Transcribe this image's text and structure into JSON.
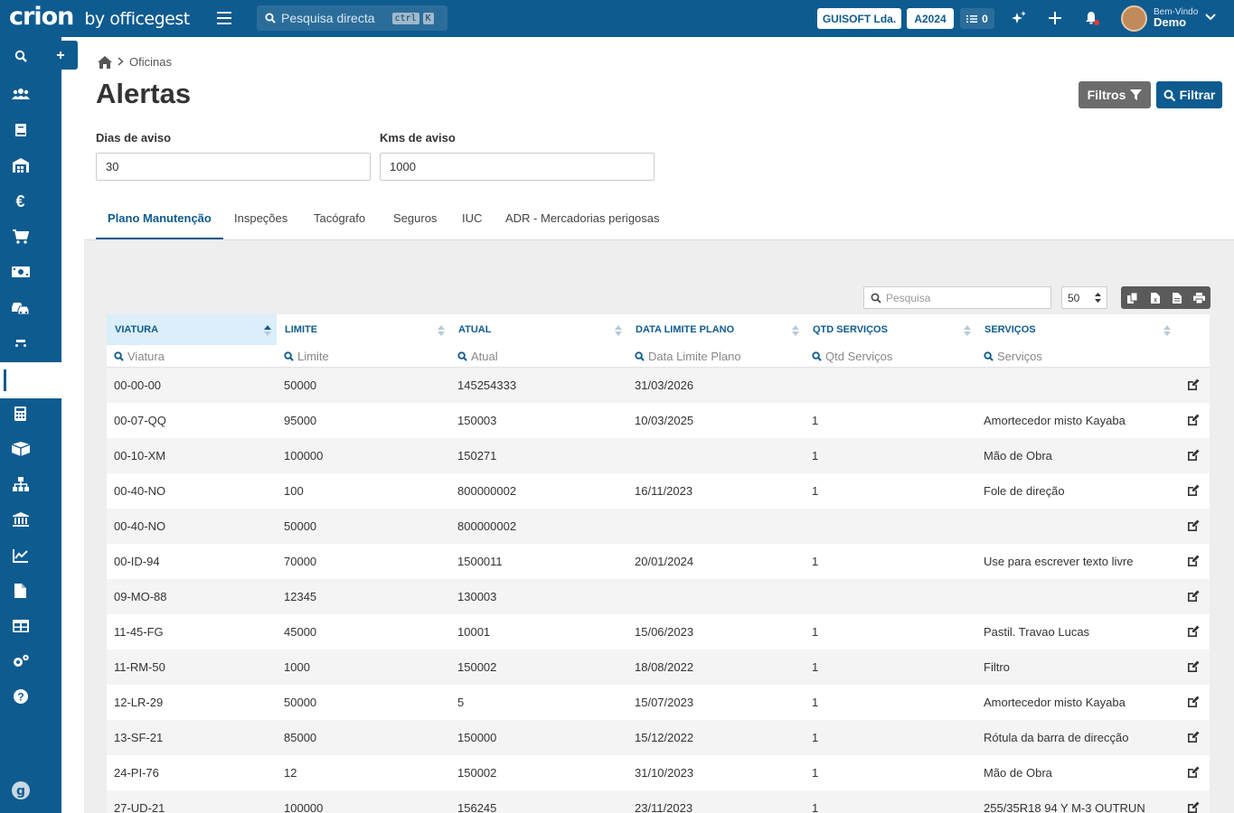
{
  "topbar": {
    "logo_main": "crion",
    "logo_sub": "by officegest",
    "search_placeholder": "Pesquisa directa",
    "shortcut_ctrl": "ctrl",
    "shortcut_k": "K",
    "company": "GUISOFT Lda.",
    "year": "A2024",
    "tasks_count": "0",
    "greeting": "Bem-Vindo",
    "username": "Demo"
  },
  "sidebar": {
    "items": [
      "search-icon",
      "users-icon",
      "book-icon",
      "warehouse-icon",
      "euro-icon",
      "cart-icon",
      "money-icon",
      "cars-icon",
      "car-icon",
      "plus-icon",
      "calculator-icon",
      "box-icon",
      "sitemap-icon",
      "bank-icon",
      "chart-icon",
      "file-icon",
      "table-icon",
      "cogs-icon",
      "help-icon",
      "brand-icon"
    ],
    "active": "car-icon"
  },
  "breadcrumb": {
    "current": "Oficinas"
  },
  "page": {
    "title": "Alertas",
    "filtros_label": "Filtros",
    "filtrar_label": "Filtrar"
  },
  "fields": {
    "dias_label": "Dias de aviso",
    "dias_value": "30",
    "kms_label": "Kms de aviso",
    "kms_value": "1000"
  },
  "tabs": [
    "Plano Manutenção",
    "Inspeções",
    "Tacógrafo",
    "Seguros",
    "IUC",
    "ADR - Mercadorias perigosas"
  ],
  "table_tools": {
    "search_placeholder": "Pesquisa",
    "page_size": "50"
  },
  "table": {
    "columns": [
      "VIATURA",
      "LIMITE",
      "ATUAL",
      "DATA LIMITE PLANO",
      "QTD SERVIÇOS",
      "SERVIÇOS"
    ],
    "filters": [
      "Viatura",
      "Limite",
      "Atual",
      "Data Limite Plano",
      "Qtd Serviços",
      "Serviços"
    ],
    "rows": [
      [
        "00-00-00",
        "50000",
        "145254333",
        "31/03/2026",
        "",
        ""
      ],
      [
        "00-07-QQ",
        "95000",
        "150003",
        "10/03/2025",
        "1",
        "Amortecedor misto Kayaba"
      ],
      [
        "00-10-XM",
        "100000",
        "150271",
        "",
        "1",
        "Mão de Obra"
      ],
      [
        "00-40-NO",
        "100",
        "800000002",
        "16/11/2023",
        "1",
        "Fole de direção"
      ],
      [
        "00-40-NO",
        "50000",
        "800000002",
        "",
        "",
        ""
      ],
      [
        "00-ID-94",
        "70000",
        "1500011",
        "20/01/2024",
        "1",
        "Use para escrever texto livre"
      ],
      [
        "09-MO-88",
        "12345",
        "130003",
        "",
        "",
        ""
      ],
      [
        "11-45-FG",
        "45000",
        "10001",
        "15/06/2023",
        "1",
        "Pastil. Travao Lucas"
      ],
      [
        "11-RM-50",
        "1000",
        "150002",
        "18/08/2022",
        "1",
        "Filtro"
      ],
      [
        "12-LR-29",
        "50000",
        "5",
        "15/07/2023",
        "1",
        "Amortecedor misto Kayaba"
      ],
      [
        "13-SF-21",
        "85000",
        "150000",
        "15/12/2022",
        "1",
        "Rótula da barra de direcção"
      ],
      [
        "24-PI-76",
        "12",
        "150002",
        "31/10/2023",
        "1",
        "Mão de Obra"
      ],
      [
        "27-UD-21",
        "100000",
        "156245",
        "23/11/2023",
        "1",
        "255/35R18 94 Y M-3 OUTRUN"
      ]
    ]
  }
}
